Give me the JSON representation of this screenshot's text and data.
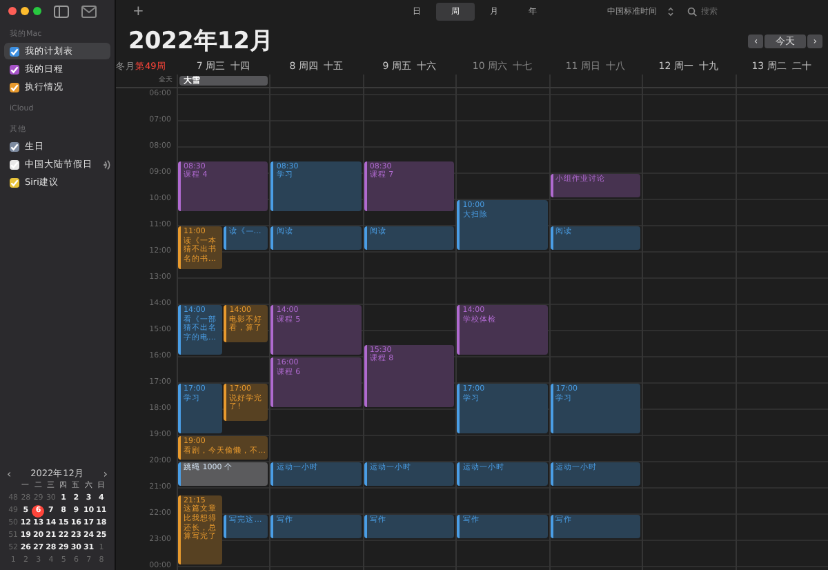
{
  "sidebar": {
    "sections": [
      {
        "title": "我的Mac",
        "items": [
          {
            "label": "我的计划表",
            "color": "#3d8fe0",
            "checked": true,
            "selected": true,
            "subscribed": false
          },
          {
            "label": "我的日程",
            "color": "#a653c8",
            "checked": true,
            "selected": false,
            "subscribed": false
          },
          {
            "label": "执行情况",
            "color": "#e89a2e",
            "checked": true,
            "selected": false,
            "subscribed": false
          }
        ]
      },
      {
        "title": "iCloud"
      },
      {
        "title": "其他",
        "items": [
          {
            "label": "生日",
            "color": "#7d8ba0",
            "checked": true,
            "selected": false,
            "subscribed": false
          },
          {
            "label": "中国大陆节假日",
            "color": "#e8e8e8",
            "checked": true,
            "selected": false,
            "subscribed": true
          },
          {
            "label": "Siri建议",
            "color": "#e8c33a",
            "checked": true,
            "selected": false,
            "subscribed": false
          }
        ]
      }
    ],
    "mini_calendar": {
      "prev": "‹",
      "title": "2022年12月",
      "next": "›",
      "weekdays": [
        "一",
        "二",
        "三",
        "四",
        "五",
        "六",
        "日"
      ],
      "weeks": [
        {
          "week": "48",
          "days": [
            {
              "d": "28",
              "in_month": false,
              "selected": false
            },
            {
              "d": "29",
              "in_month": false,
              "selected": false
            },
            {
              "d": "30",
              "in_month": false,
              "selected": false
            },
            {
              "d": "1",
              "in_month": true,
              "selected": false
            },
            {
              "d": "2",
              "in_month": true,
              "selected": false
            },
            {
              "d": "3",
              "in_month": true,
              "selected": false
            },
            {
              "d": "4",
              "in_month": true,
              "selected": false
            }
          ]
        },
        {
          "week": "49",
          "days": [
            {
              "d": "5",
              "in_month": true,
              "selected": false
            },
            {
              "d": "6",
              "in_month": true,
              "selected": true
            },
            {
              "d": "7",
              "in_month": true,
              "selected": false
            },
            {
              "d": "8",
              "in_month": true,
              "selected": false
            },
            {
              "d": "9",
              "in_month": true,
              "selected": false
            },
            {
              "d": "10",
              "in_month": true,
              "selected": false
            },
            {
              "d": "11",
              "in_month": true,
              "selected": false
            }
          ]
        },
        {
          "week": "50",
          "days": [
            {
              "d": "12",
              "in_month": true,
              "selected": false
            },
            {
              "d": "13",
              "in_month": true,
              "selected": false
            },
            {
              "d": "14",
              "in_month": true,
              "selected": false
            },
            {
              "d": "15",
              "in_month": true,
              "selected": false
            },
            {
              "d": "16",
              "in_month": true,
              "selected": false
            },
            {
              "d": "17",
              "in_month": true,
              "selected": false
            },
            {
              "d": "18",
              "in_month": true,
              "selected": false
            }
          ]
        },
        {
          "week": "51",
          "days": [
            {
              "d": "19",
              "in_month": true,
              "selected": false
            },
            {
              "d": "20",
              "in_month": true,
              "selected": false
            },
            {
              "d": "21",
              "in_month": true,
              "selected": false
            },
            {
              "d": "22",
              "in_month": true,
              "selected": false
            },
            {
              "d": "23",
              "in_month": true,
              "selected": false
            },
            {
              "d": "24",
              "in_month": true,
              "selected": false
            },
            {
              "d": "25",
              "in_month": true,
              "selected": false
            }
          ]
        },
        {
          "week": "52",
          "days": [
            {
              "d": "26",
              "in_month": true,
              "selected": false
            },
            {
              "d": "27",
              "in_month": true,
              "selected": false
            },
            {
              "d": "28",
              "in_month": true,
              "selected": false
            },
            {
              "d": "29",
              "in_month": true,
              "selected": false
            },
            {
              "d": "30",
              "in_month": true,
              "selected": false
            },
            {
              "d": "31",
              "in_month": true,
              "selected": false
            },
            {
              "d": "1",
              "in_month": false,
              "selected": false
            }
          ]
        },
        {
          "week": "1",
          "days": [
            {
              "d": "2",
              "in_month": false,
              "selected": false
            },
            {
              "d": "3",
              "in_month": false,
              "selected": false
            },
            {
              "d": "4",
              "in_month": false,
              "selected": false
            },
            {
              "d": "5",
              "in_month": false,
              "selected": false
            },
            {
              "d": "6",
              "in_month": false,
              "selected": false
            },
            {
              "d": "7",
              "in_month": false,
              "selected": false
            },
            {
              "d": "8",
              "in_month": false,
              "selected": false
            }
          ]
        }
      ]
    }
  },
  "toolbar": {
    "add": "+",
    "views": [
      {
        "label": "日",
        "selected": false
      },
      {
        "label": "周",
        "selected": true
      },
      {
        "label": "月",
        "selected": false
      },
      {
        "label": "年",
        "selected": false
      }
    ],
    "timezone": "中国标准时间",
    "search": {
      "placeholder": "搜索"
    }
  },
  "title": "2022年12月",
  "nav": {
    "prev": "‹",
    "today": "今天",
    "next": "›"
  },
  "week_label": {
    "month": "冬月",
    "week": "第49周"
  },
  "all_day_label": "全天",
  "hours": [
    "06:00",
    "07:00",
    "08:00",
    "09:00",
    "10:00",
    "11:00",
    "12:00",
    "13:00",
    "14:00",
    "15:00",
    "16:00",
    "17:00",
    "18:00",
    "19:00",
    "20:00",
    "21:00",
    "22:00",
    "23:00",
    "00:00"
  ],
  "days": [
    {
      "day": "7 周三",
      "lunar": "十四",
      "weekend": false,
      "all_day": [
        {
          "title": "大雪"
        }
      ],
      "events": [
        {
          "time": "08:30",
          "title": "课程 4",
          "color": "#b06ad0",
          "selected": false
        },
        {
          "time": "11:00",
          "title": "读《一本猜不出书名的书…",
          "color": "#e89a2e",
          "selected": false
        },
        {
          "title": "读《—…",
          "color": "#4a9ee6",
          "selected": false
        },
        {
          "time": "14:00",
          "title": "看《一部猜不出名字的电…",
          "color": "#4a9ee6",
          "selected": false
        },
        {
          "time": "14:00",
          "title": "电影不好看，算了",
          "color": "#e89a2e",
          "selected": false
        },
        {
          "time": "17:00",
          "title": "学习",
          "color": "#4a9ee6",
          "selected": false
        },
        {
          "time": "17:00",
          "title": "说好学完了!",
          "color": "#e89a2e",
          "selected": false
        },
        {
          "time": "19:00",
          "title": "看剧，今天偷懒，不…",
          "color": "#e89a2e",
          "selected": false
        },
        {
          "title": "跳绳 1000 个",
          "color": "#4a9ee6",
          "selected": true
        },
        {
          "time": "21:15",
          "title": "这篇文章比我想得还长，总算写完了",
          "color": "#e89a2e",
          "selected": false
        },
        {
          "title": "写完这…",
          "color": "#4a9ee6",
          "selected": false
        }
      ]
    },
    {
      "day": "8 周四",
      "lunar": "十五",
      "weekend": false,
      "events": [
        {
          "time": "08:30",
          "title": "学习",
          "color": "#4a9ee6",
          "selected": false
        },
        {
          "title": "阅读",
          "color": "#4a9ee6",
          "selected": false
        },
        {
          "time": "14:00",
          "title": "课程 5",
          "color": "#b06ad0",
          "selected": false
        },
        {
          "time": "16:00",
          "title": "课程 6",
          "color": "#b06ad0",
          "selected": false
        },
        {
          "title": "运动一小时",
          "color": "#4a9ee6",
          "selected": false
        },
        {
          "title": "写作",
          "color": "#4a9ee6",
          "selected": false
        }
      ]
    },
    {
      "day": "9 周五",
      "lunar": "十六",
      "weekend": false,
      "events": [
        {
          "time": "08:30",
          "title": "课程 7",
          "color": "#b06ad0",
          "selected": false
        },
        {
          "title": "阅读",
          "color": "#4a9ee6",
          "selected": false
        },
        {
          "time": "15:30",
          "title": "课程 8",
          "color": "#b06ad0",
          "selected": false
        },
        {
          "title": "运动一小时",
          "color": "#4a9ee6",
          "selected": false
        },
        {
          "title": "写作",
          "color": "#4a9ee6",
          "selected": false
        }
      ]
    },
    {
      "day": "10 周六",
      "lunar": "十七",
      "weekend": true,
      "events": [
        {
          "time": "10:00",
          "title": "大扫除",
          "color": "#4a9ee6",
          "selected": false
        },
        {
          "time": "14:00",
          "title": "学校体检",
          "color": "#b06ad0",
          "selected": false
        },
        {
          "time": "17:00",
          "title": "学习",
          "color": "#4a9ee6",
          "selected": false
        },
        {
          "title": "运动一小时",
          "color": "#4a9ee6",
          "selected": false
        },
        {
          "title": "写作",
          "color": "#4a9ee6",
          "selected": false
        }
      ]
    },
    {
      "day": "11 周日",
      "lunar": "十八",
      "weekend": true,
      "events": [
        {
          "title": "小组作业讨论",
          "color": "#b06ad0",
          "selected": false
        },
        {
          "title": "阅读",
          "color": "#4a9ee6",
          "selected": false
        },
        {
          "time": "17:00",
          "title": "学习",
          "color": "#4a9ee6",
          "selected": false
        },
        {
          "title": "运动一小时",
          "color": "#4a9ee6",
          "selected": false
        },
        {
          "title": "写作",
          "color": "#4a9ee6",
          "selected": false
        }
      ]
    },
    {
      "day": "12 周一",
      "lunar": "十九",
      "weekend": false
    },
    {
      "day": "13 周二",
      "lunar": "二十",
      "weekend": false
    }
  ]
}
